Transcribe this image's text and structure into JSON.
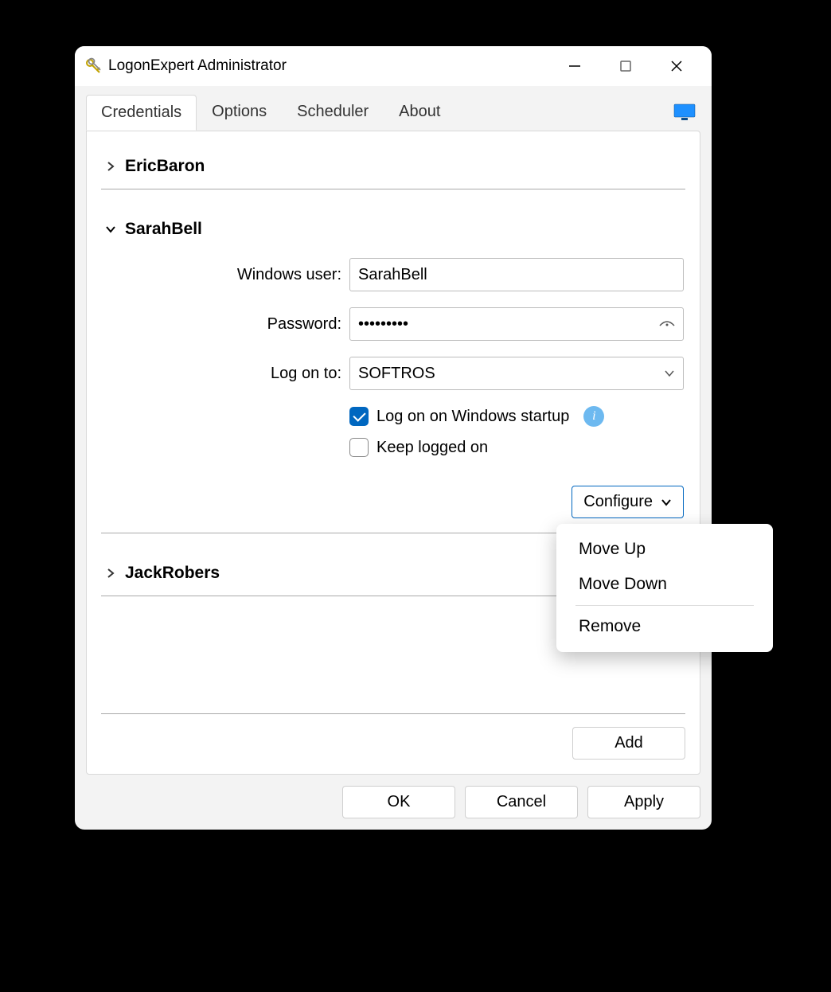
{
  "window": {
    "title": "LogonExpert Administrator"
  },
  "tabs": {
    "credentials": "Credentials",
    "options": "Options",
    "scheduler": "Scheduler",
    "about": "About"
  },
  "users": {
    "eric": "EricBaron",
    "sarah": "SarahBell",
    "jack": "JackRobers"
  },
  "form": {
    "user_label": "Windows user:",
    "user_value": "SarahBell",
    "password_label": "Password:",
    "password_value": "•••••••••",
    "logon_label": "Log on to:",
    "logon_value": "SOFTROS",
    "startup_label": "Log on on Windows startup",
    "keep_label": "Keep logged on",
    "configure_label": "Configure"
  },
  "menu": {
    "move_up": "Move Up",
    "move_down": "Move Down",
    "remove": "Remove"
  },
  "buttons": {
    "add": "Add",
    "ok": "OK",
    "cancel": "Cancel",
    "apply": "Apply"
  }
}
